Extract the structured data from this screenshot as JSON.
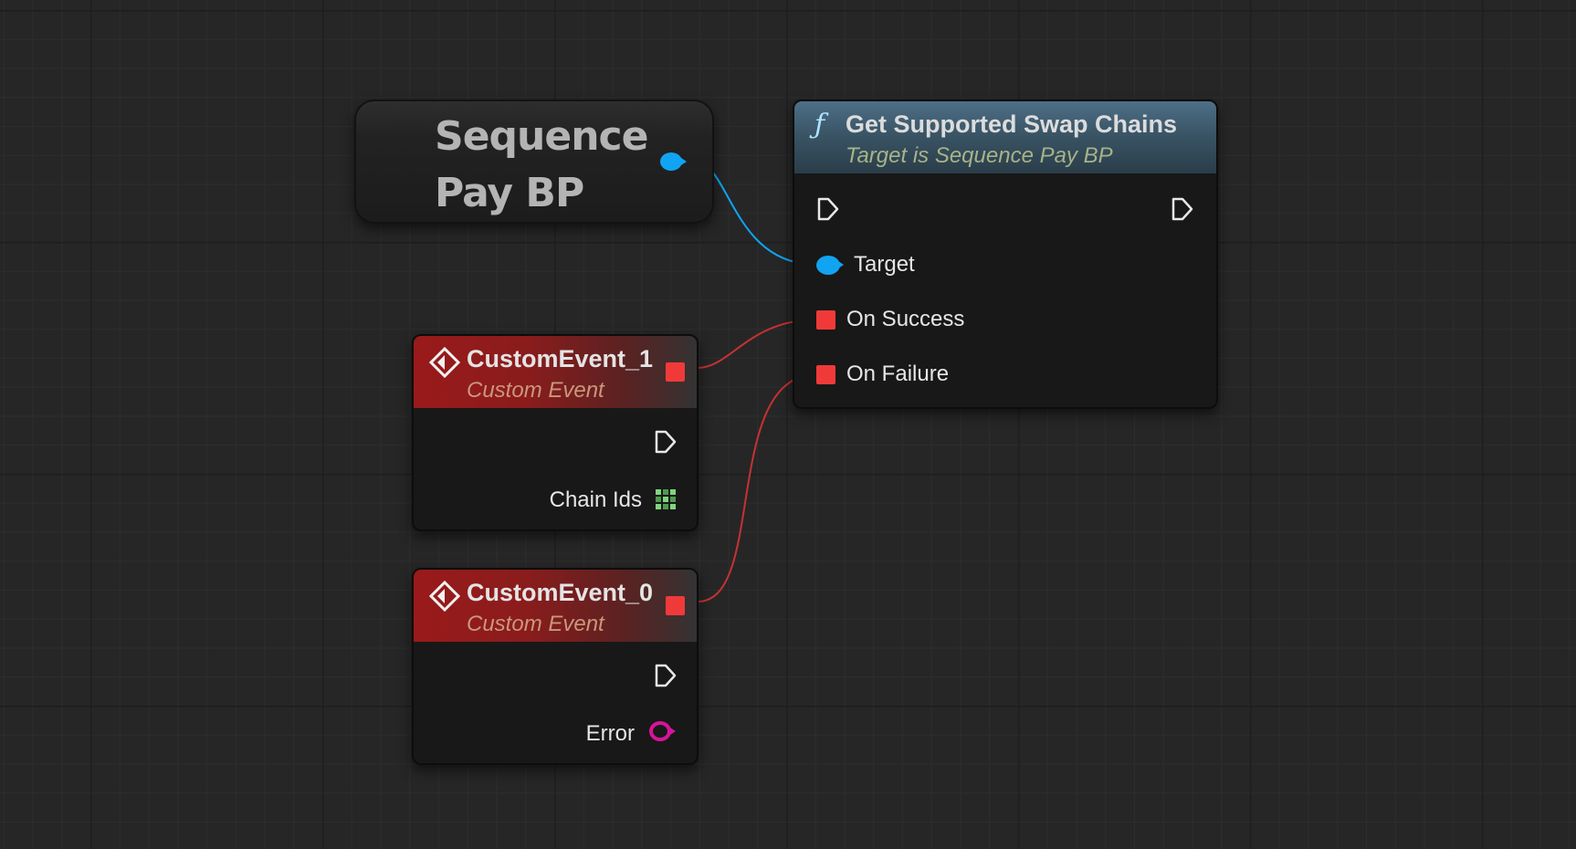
{
  "graph": {
    "variable_node": {
      "title_line1": "Sequence",
      "title_line2": "Pay BP",
      "pin_color": "#11a4f2"
    },
    "function_node": {
      "icon": "function-icon",
      "title": "Get Supported Swap Chains",
      "subtitle": "Target is Sequence Pay BP",
      "pins": {
        "target": "Target",
        "on_success": "On Success",
        "on_failure": "On Failure"
      },
      "header_color": "#3a5566"
    },
    "event_nodes": [
      {
        "title": "CustomEvent_1",
        "subtitle": "Custom Event",
        "param_label": "Chain Ids",
        "param_icon": "array-grid-icon",
        "param_color": "#7ed67e"
      },
      {
        "title": "CustomEvent_0",
        "subtitle": "Custom Event",
        "param_label": "Error",
        "param_icon": "struct-pin-icon",
        "param_color": "#d6149b"
      }
    ],
    "colors": {
      "delegate_pin": "#f03a3a",
      "object_wire": "#11a4f2",
      "delegate_wire": "#c63232",
      "event_header": "#8a1c1c"
    }
  }
}
